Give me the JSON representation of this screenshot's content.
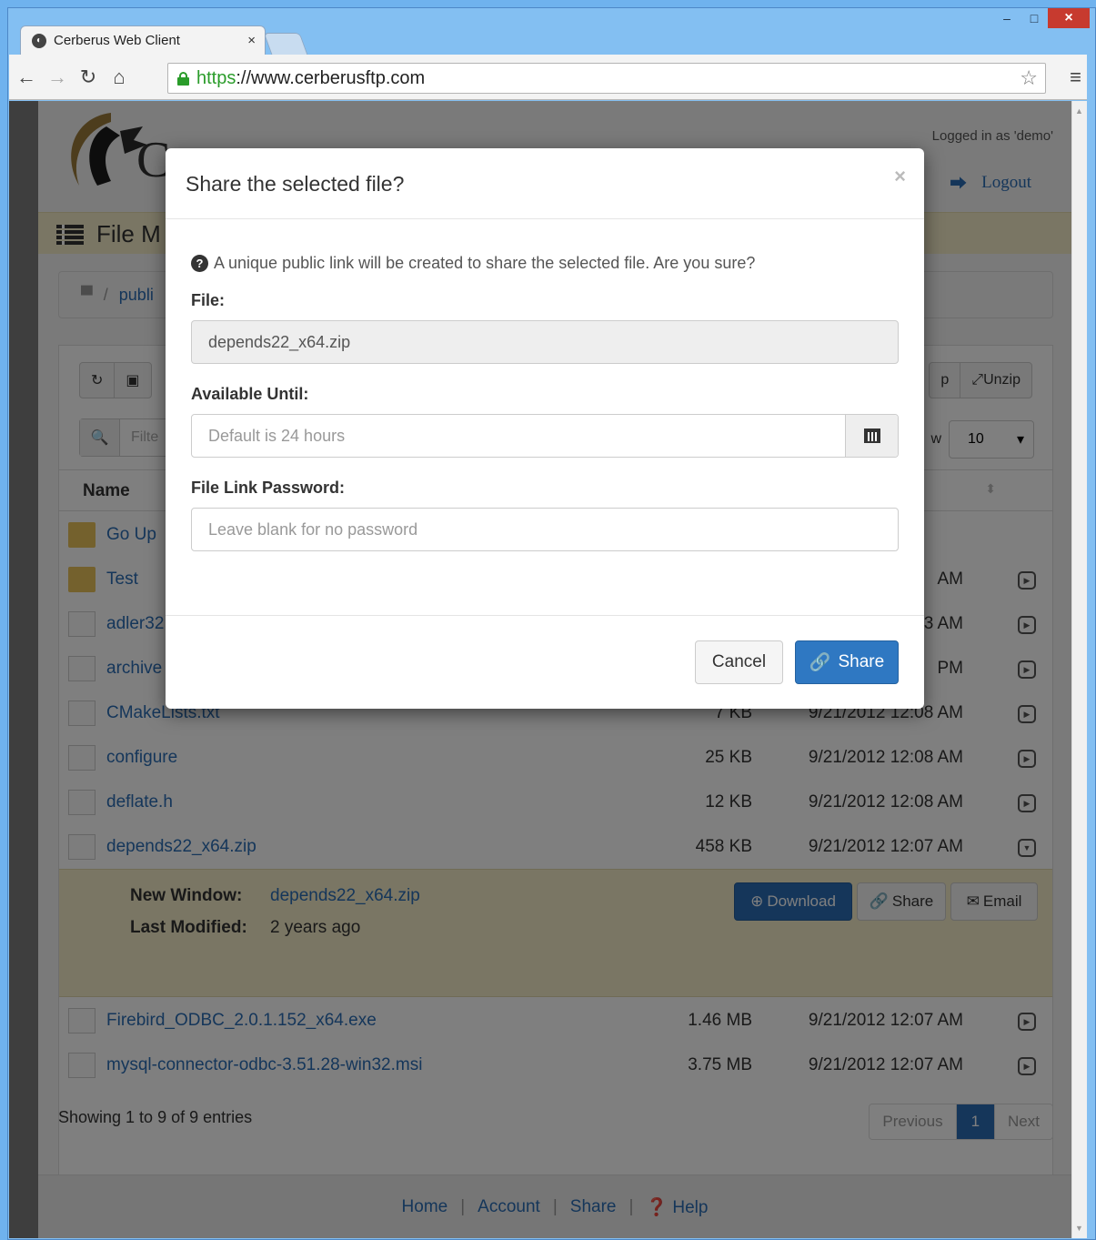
{
  "browser": {
    "tab_title": "Cerberus Web Client",
    "tab_close": "×",
    "url_scheme": "https",
    "url_rest": "://www.cerberusftp.com",
    "window_controls": {
      "minimize": "–",
      "maximize": "□",
      "close": "×"
    }
  },
  "header": {
    "logged_in": "Logged in as 'demo'",
    "logout": "Logout",
    "page_title": "File M"
  },
  "breadcrumb": {
    "sep": "/",
    "folder": "publi"
  },
  "toolbar": {
    "filter_placeholder": "Filte",
    "unzip_label": "Unzip",
    "zip_partial": "p",
    "show_partial": "w",
    "page_size": "10"
  },
  "table": {
    "name_header": "Name",
    "rows": [
      {
        "name": "Go Up",
        "size": "",
        "date": ""
      },
      {
        "name": "Test",
        "size": "",
        "date": "AM"
      },
      {
        "name": "adler32",
        "size": "",
        "date": "3 AM"
      },
      {
        "name": "archive",
        "size": "",
        "date": "PM"
      },
      {
        "name": "CMakeLists.txt",
        "size": "7 KB",
        "date": "9/21/2012 12:08 AM"
      },
      {
        "name": "configure",
        "size": "25 KB",
        "date": "9/21/2012 12:08 AM"
      },
      {
        "name": "deflate.h",
        "size": "12 KB",
        "date": "9/21/2012 12:08 AM"
      },
      {
        "name": "depends22_x64.zip",
        "size": "458 KB",
        "date": "9/21/2012 12:07 AM"
      },
      {
        "name": "Firebird_ODBC_2.0.1.152_x64.exe",
        "size": "1.46 MB",
        "date": "9/21/2012 12:07 AM"
      },
      {
        "name": "mysql-connector-odbc-3.51.28-win32.msi",
        "size": "3.75 MB",
        "date": "9/21/2012 12:07 AM"
      }
    ]
  },
  "detail": {
    "new_window_label": "New Window:",
    "new_window_value": "depends22_x64.zip",
    "last_modified_label": "Last Modified:",
    "last_modified_value": "2 years ago",
    "download_label": "Download",
    "share_label": "Share",
    "email_label": "Email"
  },
  "pagination": {
    "info": "Showing 1 to 9 of 9 entries",
    "previous": "Previous",
    "current": "1",
    "next": "Next"
  },
  "footer": {
    "home": "Home",
    "account": "Account",
    "share": "Share",
    "help": "Help",
    "sep": "|"
  },
  "modal": {
    "title": "Share the selected file?",
    "close": "×",
    "question": "A unique public link will be created to share the selected file. Are you sure?",
    "file_label": "File:",
    "file_value": "depends22_x64.zip",
    "available_label": "Available Until:",
    "available_placeholder": "Default is 24 hours",
    "password_label": "File Link Password:",
    "password_placeholder": "Leave blank for no password",
    "cancel_label": "Cancel",
    "share_label": "Share"
  },
  "colors": {
    "accent": "#2f78c2",
    "link": "#2a6db5",
    "header_bar": "#f4ecc9"
  }
}
